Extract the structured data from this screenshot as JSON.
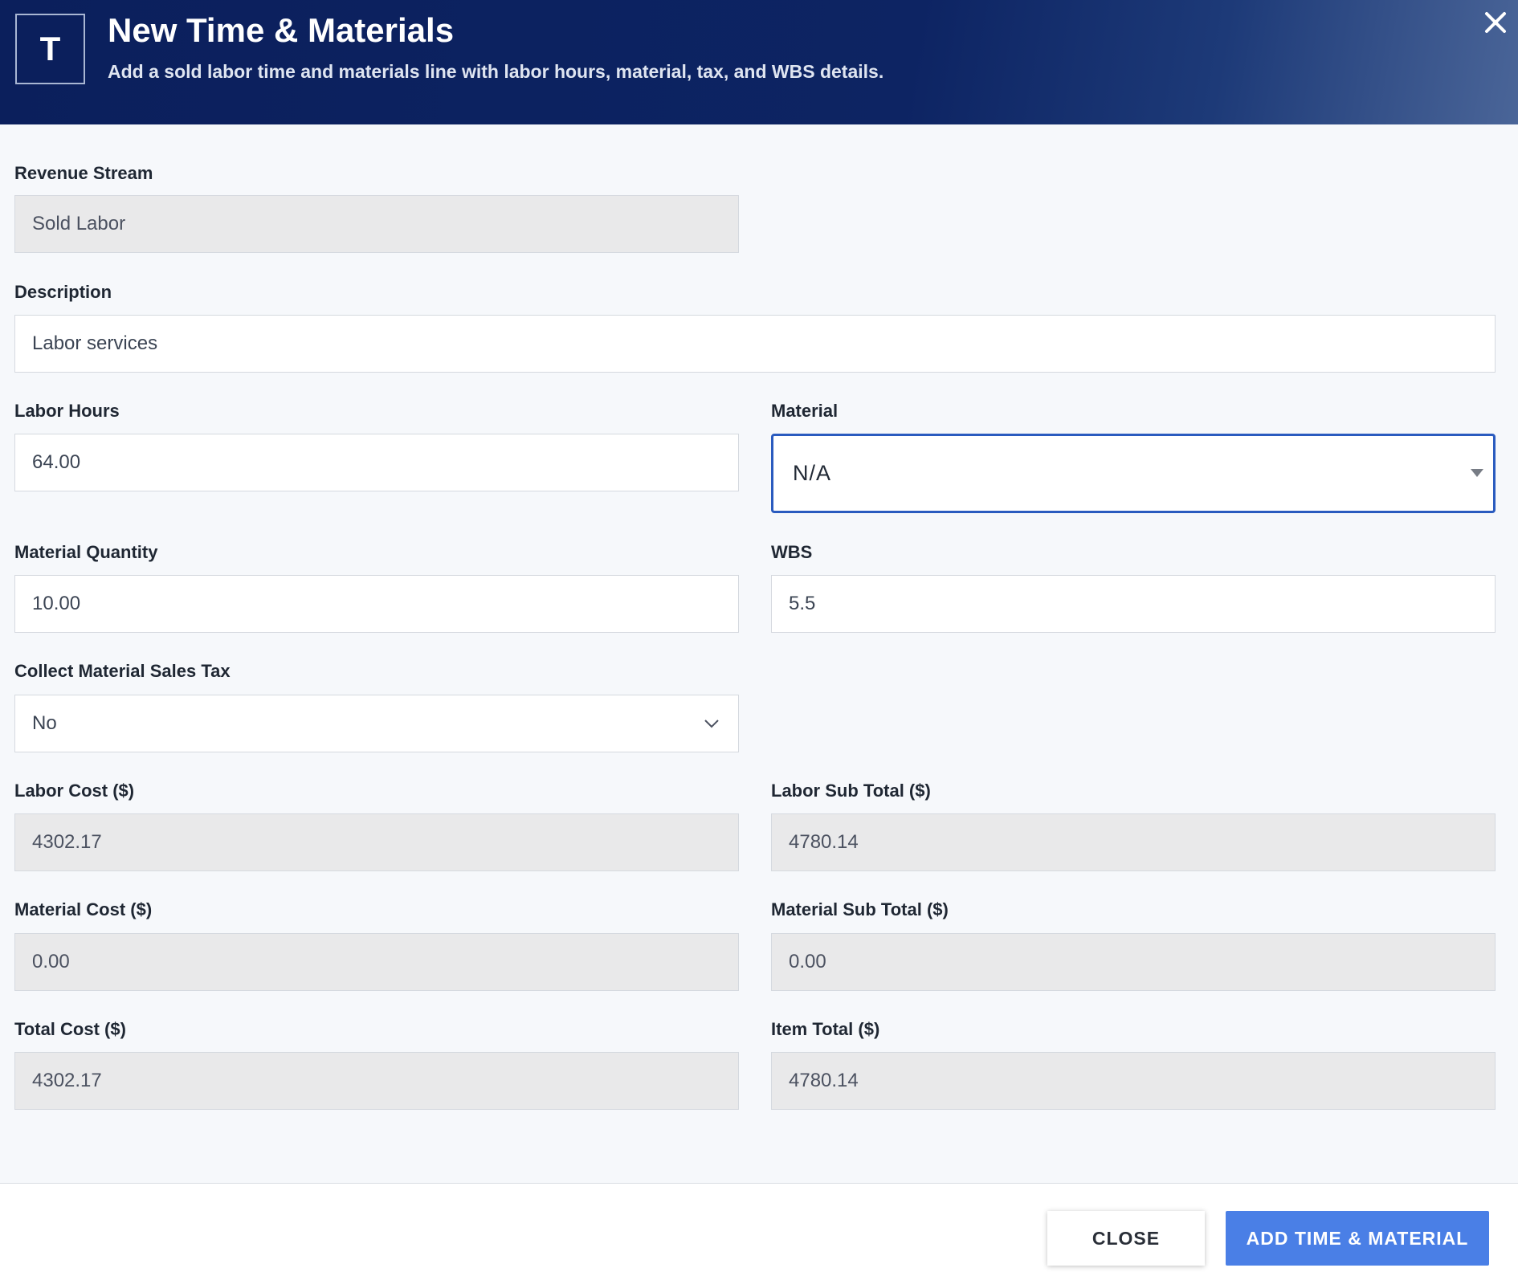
{
  "header": {
    "logo_letter": "T",
    "title": "New Time & Materials",
    "subtitle": "Add a sold labor time and materials line with labor hours, material, tax, and WBS details.",
    "close_icon": "close-icon"
  },
  "form": {
    "revenue_stream": {
      "label": "Revenue Stream",
      "value": "Sold Labor"
    },
    "description": {
      "label": "Description",
      "value": "Labor services"
    },
    "labor_hours": {
      "label": "Labor Hours",
      "value": "64.00"
    },
    "material": {
      "label": "Material",
      "value": "N/A"
    },
    "material_quantity": {
      "label": "Material Quantity",
      "value": "10.00"
    },
    "wbs": {
      "label": "WBS",
      "value": "5.5"
    },
    "collect_tax": {
      "label": "Collect Material Sales Tax",
      "value": "No"
    },
    "labor_cost": {
      "label": "Labor Cost ($)",
      "value": "4302.17"
    },
    "labor_sub_total": {
      "label": "Labor Sub Total ($)",
      "value": "4780.14"
    },
    "material_cost": {
      "label": "Material Cost ($)",
      "value": "0.00"
    },
    "material_sub_total": {
      "label": "Material Sub Total ($)",
      "value": "0.00"
    },
    "total_cost": {
      "label": "Total Cost ($)",
      "value": "4302.17"
    },
    "item_total": {
      "label": "Item Total ($)",
      "value": "4780.14"
    }
  },
  "footer": {
    "close_label": "CLOSE",
    "add_label": "ADD TIME & MATERIAL"
  },
  "colors": {
    "header_bg": "#0b1f5c",
    "primary_button": "#4a7fe6",
    "focus_border": "#2a5bbf",
    "readonly_bg": "#e9e9ea"
  }
}
